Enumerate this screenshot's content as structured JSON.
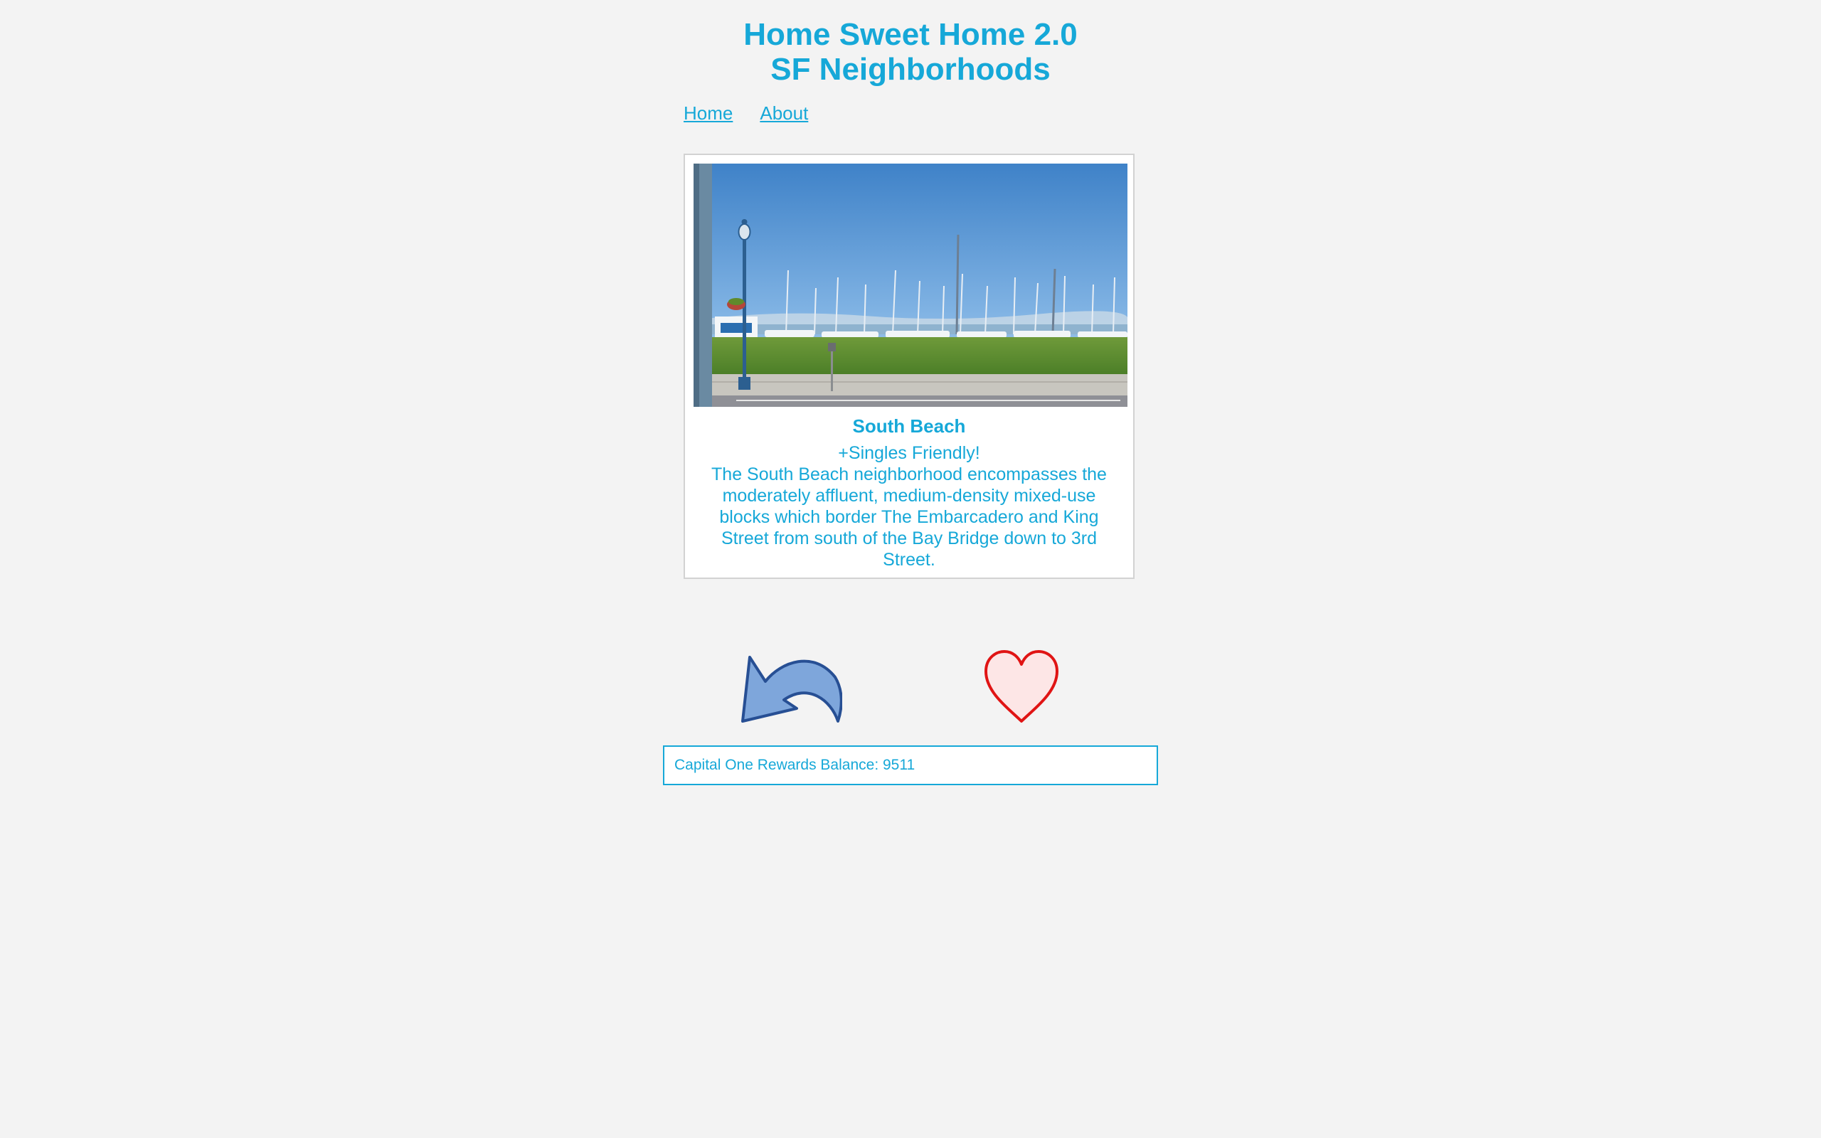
{
  "header": {
    "title_line1": "Home Sweet Home 2.0",
    "title_line2": "SF Neighborhoods"
  },
  "nav": {
    "home_label": "Home",
    "about_label": "About"
  },
  "listing": {
    "name": "South Beach",
    "tag": "+Singles Friendly!",
    "description": "The South Beach neighborhood encompasses the moderately affluent, medium-density mixed-use blocks which border The Embarcadero and King Street from south of the Bay Bridge down to 3rd Street."
  },
  "actions": {
    "back_icon": "back-arrow-icon",
    "like_icon": "heart-icon"
  },
  "rewards": {
    "text": "Capital One Rewards Balance: 9511"
  },
  "colors": {
    "accent": "#16a8d8",
    "background": "#f3f3f3",
    "arrow_fill": "#7ea6db",
    "heart_stroke": "#e01414"
  }
}
